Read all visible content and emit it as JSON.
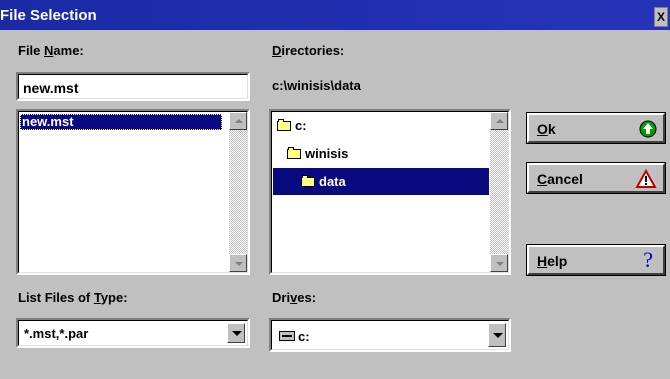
{
  "window": {
    "title": "File Selection",
    "close_glyph": "X"
  },
  "file_name": {
    "label_pre": "File ",
    "label_key": "N",
    "label_post": "ame:",
    "value": "new.mst",
    "list": [
      "new.mst"
    ]
  },
  "directories": {
    "label_key": "D",
    "label_post": "irectories:",
    "path": "c:\\winisis\\data",
    "tree": [
      "c:",
      "winisis",
      "data"
    ]
  },
  "list_type": {
    "label_pre": "List Files of ",
    "label_key": "T",
    "label_post": "ype:",
    "value": "*.mst,*.par"
  },
  "drives": {
    "label_pre": "Dri",
    "label_key": "v",
    "label_post": "es:",
    "value": "c:"
  },
  "buttons": {
    "ok": {
      "key": "O",
      "rest": "k"
    },
    "cancel": {
      "key": "C",
      "rest": "ancel"
    },
    "help": {
      "key": "H",
      "rest": "elp"
    }
  },
  "icons": {
    "ok": "green-up-arrow-icon",
    "cancel": "warning-triangle-icon",
    "help": "question-mark-icon",
    "folder": "folder-icon",
    "drive": "hard-drive-icon"
  }
}
